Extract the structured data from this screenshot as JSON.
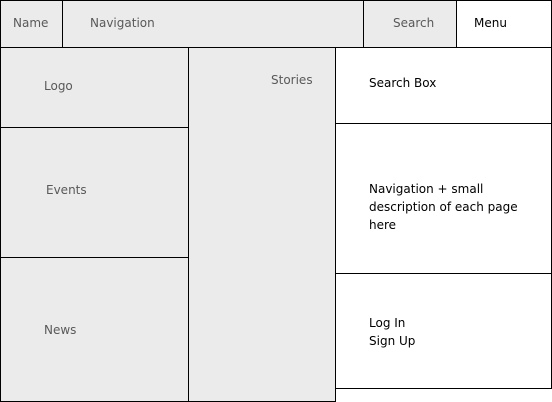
{
  "header": {
    "name": "Name",
    "navigation": "Navigation",
    "search": "Search",
    "menu": "Menu"
  },
  "left_column": {
    "logo": "Logo",
    "events": "Events",
    "news": "News"
  },
  "center_column": {
    "stories": "Stories"
  },
  "right_column": {
    "search_box": "Search Box",
    "navigation_description": "Navigation + small description of each page here",
    "log_in": "Log In",
    "sign_up": "Sign Up"
  },
  "colors": {
    "panel_fill": "#ebebeb",
    "menu_fill": "#ffffff",
    "border": "#000000",
    "muted_text": "#595959",
    "dark_text": "#000000"
  }
}
